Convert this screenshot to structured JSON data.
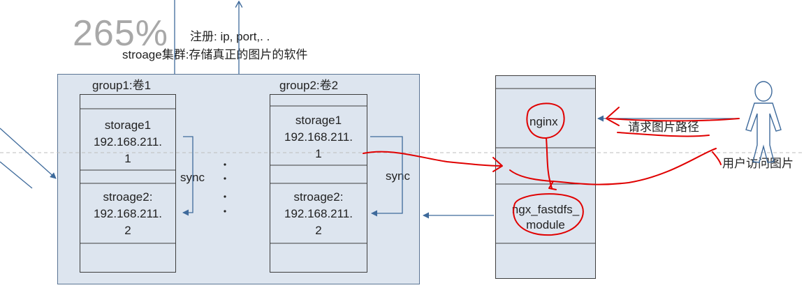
{
  "zoom_watermark": "265%",
  "register_label": "注册: ip, port,. .",
  "storage_cluster_label": "stroage集群:存储真正的图片的软件",
  "groups": [
    {
      "title": "group1:卷1",
      "storages": [
        {
          "name": "storage1",
          "ip_a": "192.168.211.",
          "ip_b": "1"
        },
        {
          "name": "stroage2:",
          "ip_a": "192.168.211.",
          "ip_b": "2"
        }
      ],
      "sync": "sync"
    },
    {
      "title": "group2:卷2",
      "storages": [
        {
          "name": "storage1",
          "ip_a": "192.168.211.",
          "ip_b": "1"
        },
        {
          "name": "stroage2:",
          "ip_a": "192.168.211.",
          "ip_b": "2"
        }
      ],
      "sync": "sync"
    }
  ],
  "ellipsis": ". . . .",
  "nginx_stack": {
    "nginx": "nginx",
    "module_a": "ngx_fastdfs_",
    "module_b": "module"
  },
  "request_label": "请求图片路径",
  "user_label": "用户访问图片",
  "colors": {
    "box_fill": "#dde5ef",
    "box_border": "#5a7494",
    "arrow": "#3e6a9b",
    "annotation": "#e00000",
    "dashed": "#bdbdbd"
  }
}
